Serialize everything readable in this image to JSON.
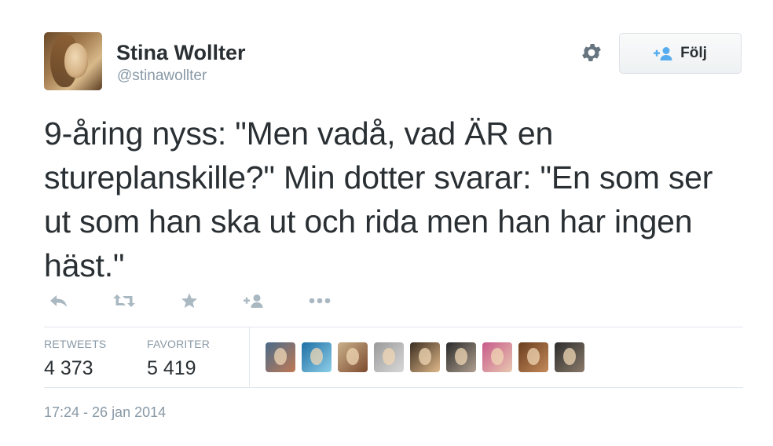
{
  "user": {
    "name": "Stina Wollter",
    "handle": "@stinawollter"
  },
  "follow": {
    "label": "Följ"
  },
  "tweet": {
    "text": "9-åring nyss: \"Men vadå, vad ÄR en stureplanskille?\" Min dotter svarar: \"En som ser ut som han ska ut och rida men han har ingen häst.\""
  },
  "actions": [
    "reply-icon",
    "retweet-icon",
    "favorite-icon",
    "follow-icon",
    "more-icon"
  ],
  "stats": {
    "retweets_label": "RETWEETS",
    "retweets_value": "4 373",
    "favorites_label": "FAVORITER",
    "favorites_value": "5 419"
  },
  "favoriters": [
    {
      "colors": [
        "#4a6b8a",
        "#c07a55"
      ]
    },
    {
      "colors": [
        "#1d6fa5",
        "#8fcfe8"
      ]
    },
    {
      "colors": [
        "#c9b08a",
        "#7d4b2e"
      ]
    },
    {
      "colors": [
        "#9a9a9a",
        "#d8d8d8"
      ]
    },
    {
      "colors": [
        "#3b2d20",
        "#e0b98a"
      ]
    },
    {
      "colors": [
        "#2a2a2a",
        "#b0a090"
      ]
    },
    {
      "colors": [
        "#c85a8a",
        "#e8c8b0"
      ]
    },
    {
      "colors": [
        "#6a3e1e",
        "#c48a5a"
      ]
    },
    {
      "colors": [
        "#2d2d2d",
        "#8a7a6a"
      ]
    }
  ],
  "timestamp": "17:24 - 26 jan 2014",
  "colors": {
    "text": "#292f33",
    "muted": "#8899a6",
    "icon": "#aab8c2",
    "accent": "#55acee"
  }
}
